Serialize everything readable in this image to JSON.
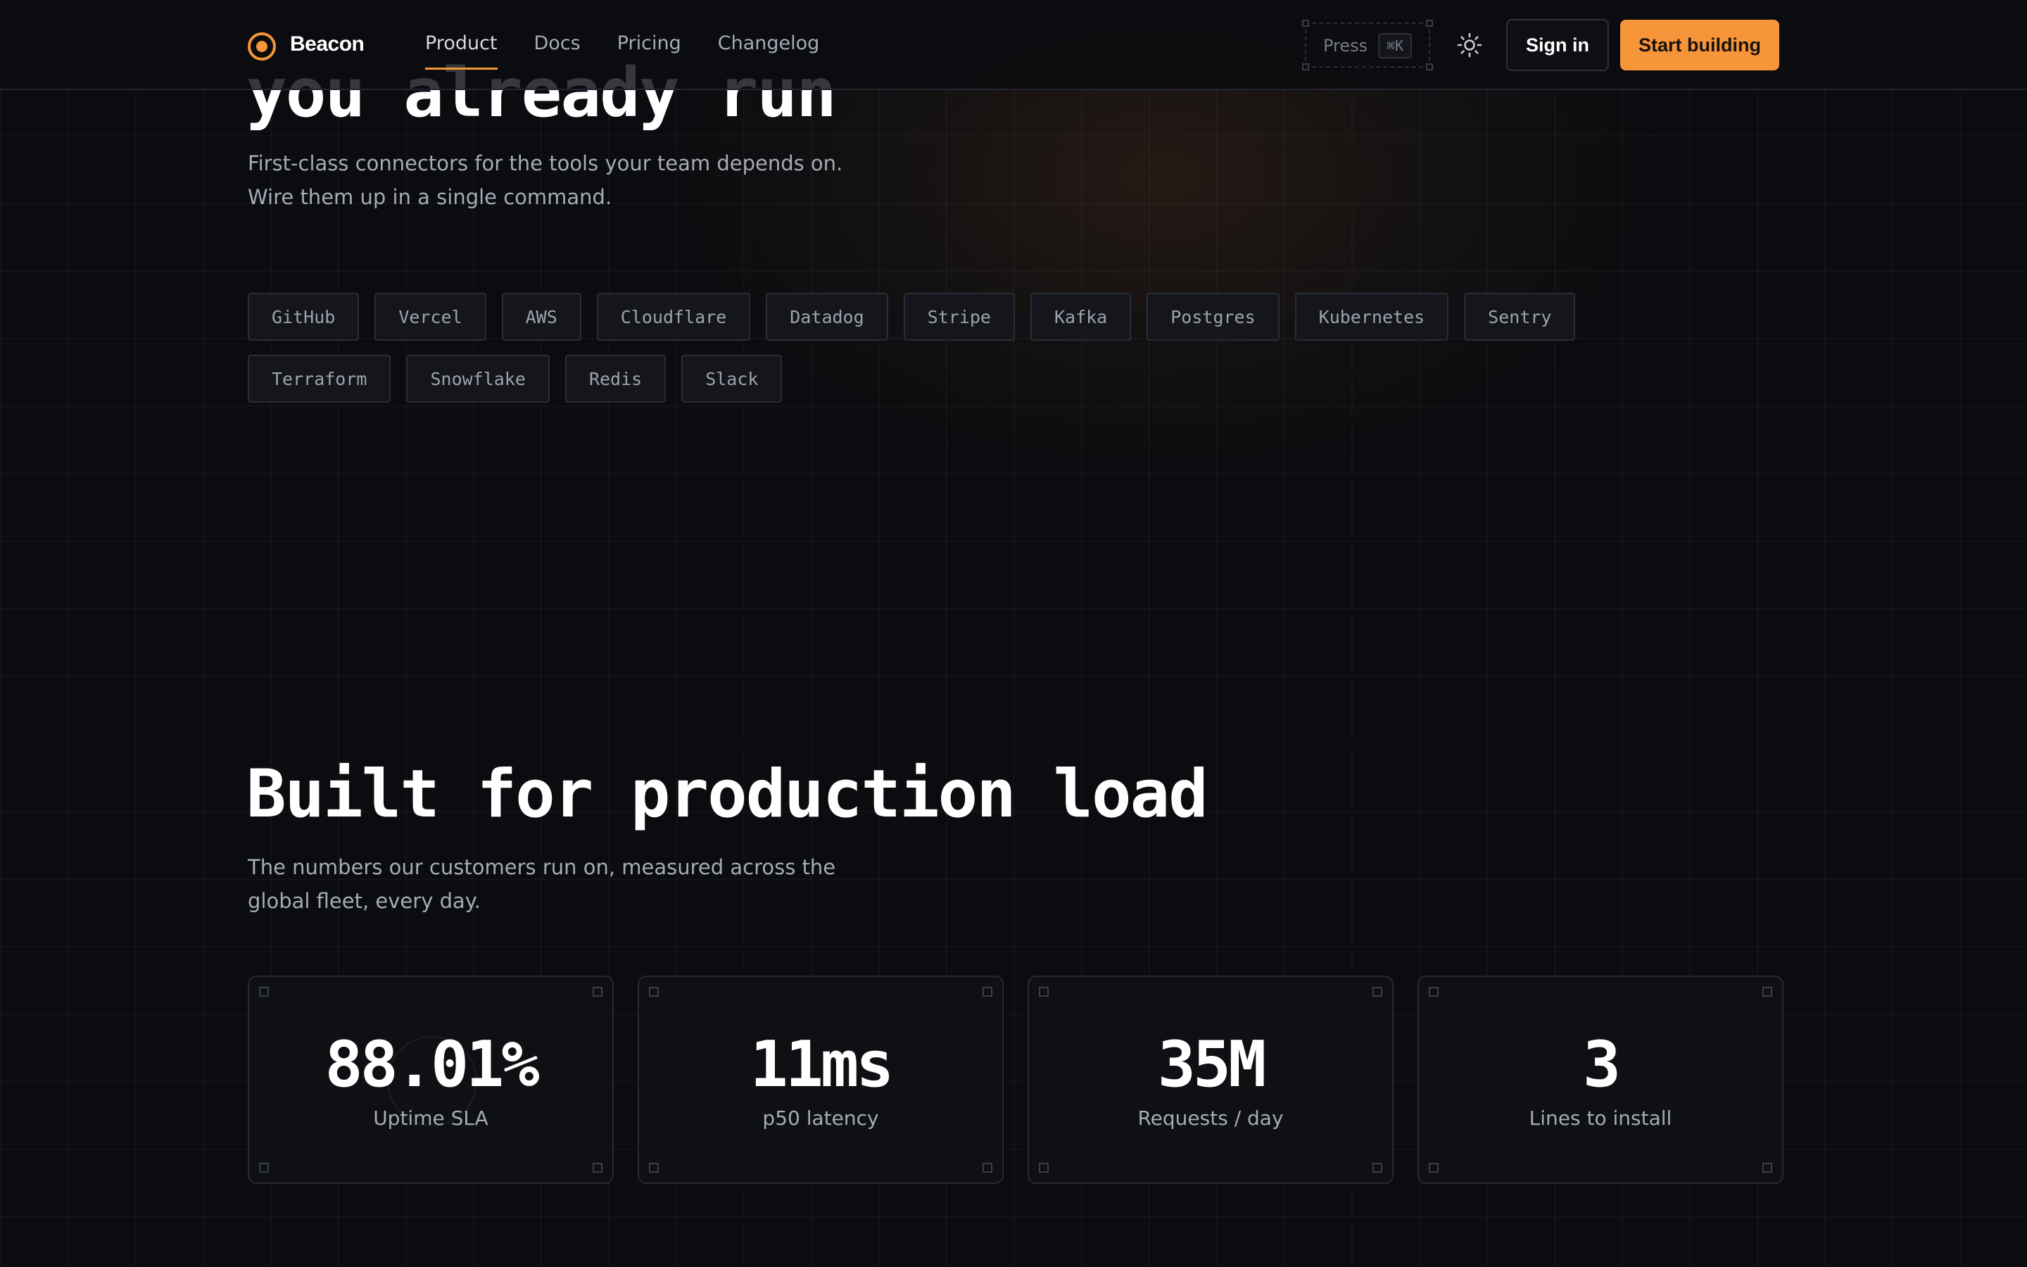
{
  "brand": {
    "name": "Beacon",
    "accent": "#f7953a"
  },
  "nav": {
    "links": [
      {
        "label": "Product",
        "active": true
      },
      {
        "label": "Docs"
      },
      {
        "label": "Pricing"
      },
      {
        "label": "Changelog"
      }
    ],
    "search_hint": "Press",
    "shortcut": "⌘K",
    "theme_icon": "sun-icon",
    "signin_label": "Sign in",
    "cta_label": "Start building"
  },
  "integrations": {
    "title_fragment": "you already run",
    "subtitle_line1": "First-class connectors for the tools your team depends on.",
    "subtitle_line2": "Wire them up in a single command.",
    "chips": [
      "GitHub",
      "Vercel",
      "AWS",
      "Cloudflare",
      "Datadog",
      "Stripe",
      "Kafka",
      "Postgres",
      "Kubernetes",
      "Sentry",
      "Terraform",
      "Snowflake",
      "Redis",
      "Slack"
    ]
  },
  "stats": {
    "title": "Built for production load",
    "subtitle_line1": "The numbers our customers run on, measured across the",
    "subtitle_line2": "global fleet, every day.",
    "cards": [
      {
        "value": "88.01%",
        "label": "Uptime SLA"
      },
      {
        "value": "11ms",
        "label": "p50 latency"
      },
      {
        "value": "35M",
        "label": "Requests / day"
      },
      {
        "value": "3",
        "label": "Lines to install"
      }
    ]
  }
}
